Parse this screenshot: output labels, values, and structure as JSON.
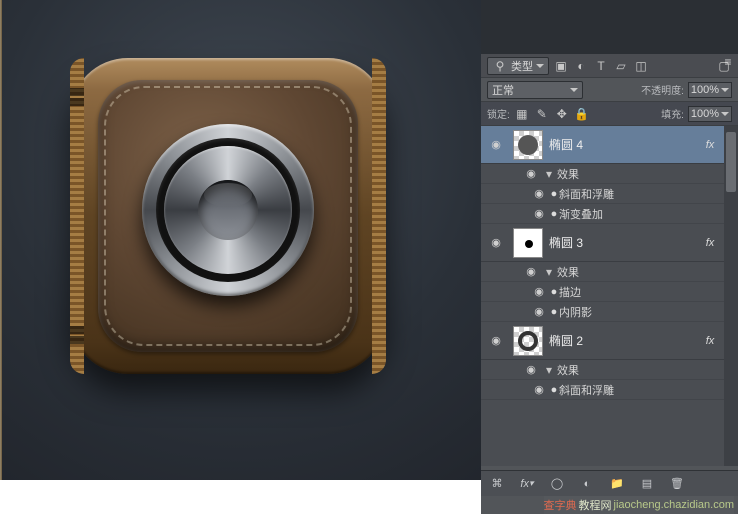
{
  "filter_label": "类型",
  "blend_mode": "正常",
  "opacity_label": "不透明度:",
  "opacity_value": "100%",
  "lock_label": "锁定:",
  "fill_label": "填充:",
  "fill_value": "100%",
  "fx_label": "fx",
  "icons": {
    "search": "⚲",
    "image": "▣",
    "adjust": "◐",
    "type": "T",
    "path": "▱",
    "smart": "◫",
    "menu": "≡",
    "eye": "◉",
    "bullet": "●",
    "chevdown": "▾",
    "chevright": "▸",
    "lock_trans": "▦",
    "lock_brush": "✎",
    "lock_move": "✥",
    "lock_all": "🔒",
    "link": "⌘",
    "mask": "◯",
    "adjustf": "◐",
    "folder": "📁",
    "new": "▤",
    "trash": "🗑"
  },
  "layers": [
    {
      "name": "椭圆 4",
      "selected": true,
      "fx": true,
      "thumb": "checker-circle",
      "fx_head": "效果",
      "fx_items": [
        "斜面和浮雕",
        "渐变叠加"
      ]
    },
    {
      "name": "椭圆 3",
      "selected": false,
      "fx": true,
      "thumb": "mask-ring",
      "fx_head": "效果",
      "fx_items": [
        "描边",
        "内阴影"
      ]
    },
    {
      "name": "椭圆 2",
      "selected": false,
      "fx": true,
      "thumb": "checker-circle",
      "fx_head": "效果",
      "fx_items": [
        "斜面和浮雕"
      ]
    }
  ],
  "watermark": {
    "a": "查字典",
    "b": "教程网",
    "c": "jiaocheng.chazidian.com"
  }
}
